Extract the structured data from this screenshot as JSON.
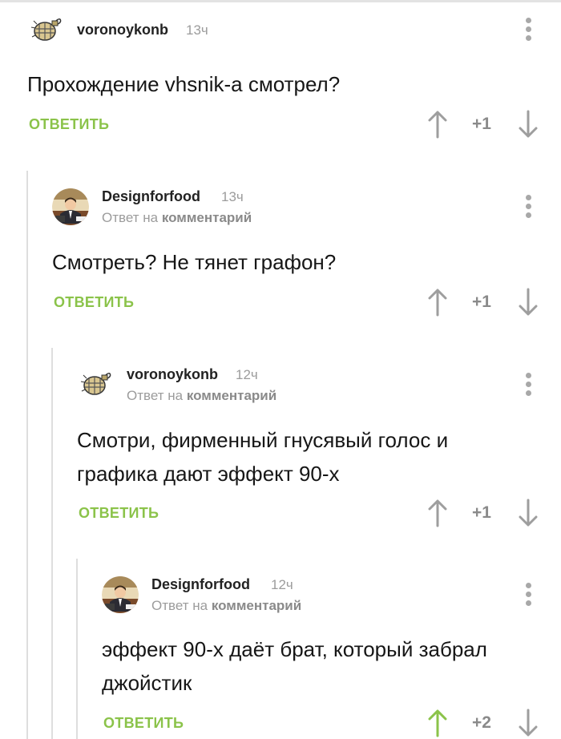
{
  "comments": [
    {
      "author": "voronoykonb",
      "time": "13ч",
      "reply_to_prefix": "",
      "reply_to_link": "",
      "text_lines": [
        "Прохождение vhsnik-а смотрел?"
      ],
      "reply_label": "ОТВЕТИТЬ",
      "score": "+1",
      "upvoted": false,
      "avatar": "grenade-avatar"
    },
    {
      "author": "Designforfood",
      "time": "13ч",
      "reply_to_prefix": "Ответ на",
      "reply_to_link": "комментарий",
      "text_lines": [
        "Смотреть? Не тянет графон?"
      ],
      "reply_label": "ОТВЕТИТЬ",
      "score": "+1",
      "upvoted": false,
      "avatar": "businessman-avatar"
    },
    {
      "author": "voronoykonb",
      "time": "12ч",
      "reply_to_prefix": "Ответ на",
      "reply_to_link": "комментарий",
      "text_lines": [
        "Смотри, фирменный гнусявый голос и",
        "графика дают эффект 90-х"
      ],
      "reply_label": "ОТВЕТИТЬ",
      "score": "+1",
      "upvoted": false,
      "avatar": "grenade-avatar"
    },
    {
      "author": "Designforfood",
      "time": "12ч",
      "reply_to_prefix": "Ответ на",
      "reply_to_link": "комментарий",
      "text_lines": [
        "эффект 90-х даёт брат, который забрал",
        "джойстик"
      ],
      "reply_label": "ОТВЕТИТЬ",
      "score": "+2",
      "upvoted": true,
      "avatar": "businessman-avatar"
    }
  ],
  "colors": {
    "accent": "#8bc34a",
    "muted": "#9c9c9c",
    "arrow": "#9e9e9e",
    "thread_line": "#dedede"
  }
}
